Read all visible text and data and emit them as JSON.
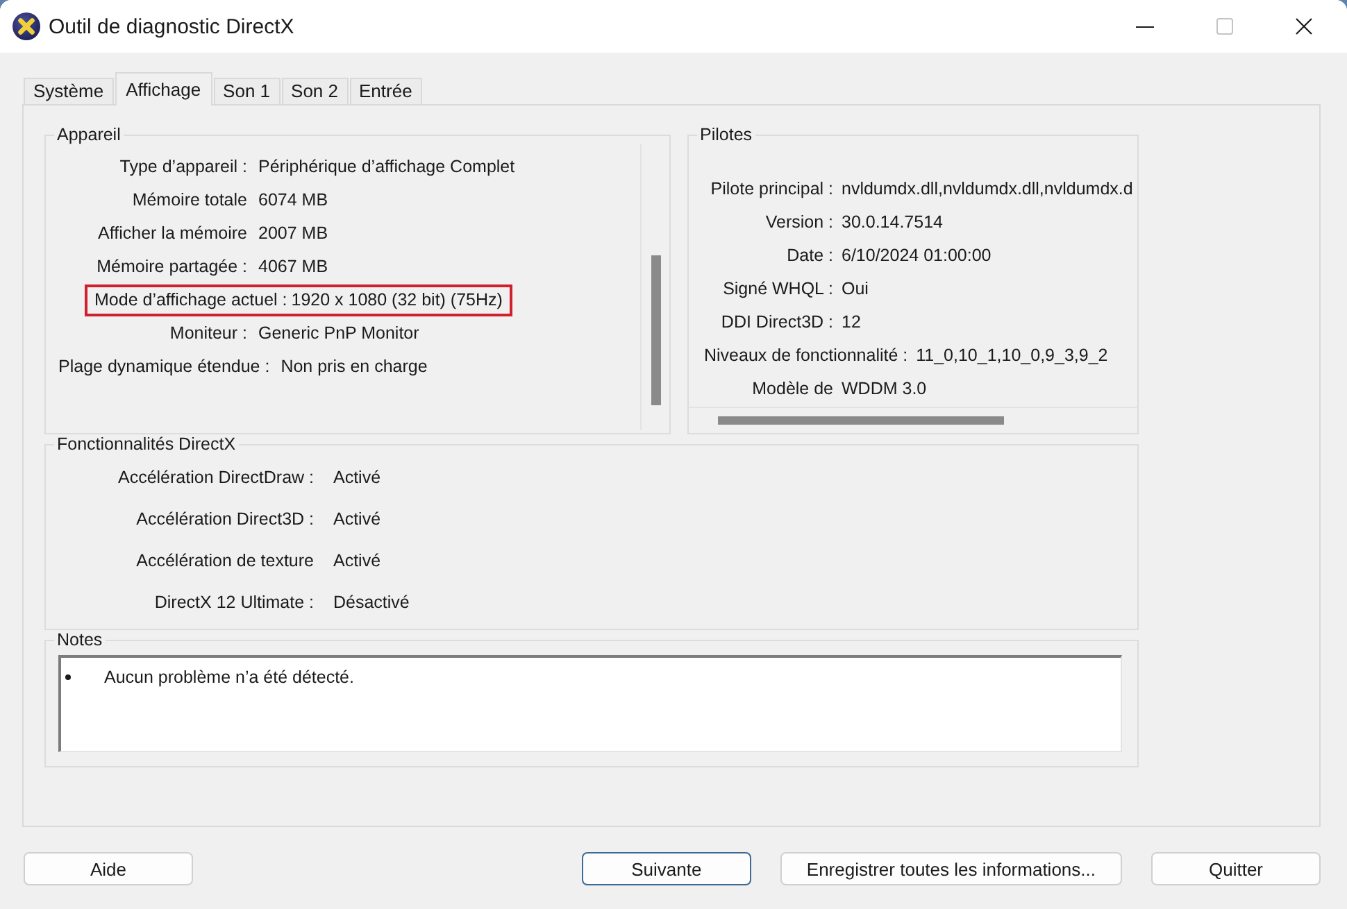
{
  "window": {
    "title": "Outil de diagnostic DirectX",
    "controls": [
      {
        "kind": "minimize",
        "disabled": false
      },
      {
        "kind": "maximize",
        "disabled": true
      },
      {
        "kind": "close",
        "disabled": false
      }
    ]
  },
  "tabs": [
    {
      "label": "Système",
      "selected": false
    },
    {
      "label": "Affichage",
      "selected": true
    },
    {
      "label": "Son 1",
      "selected": false
    },
    {
      "label": "Son 2",
      "selected": false
    },
    {
      "label": "Entrée",
      "selected": false
    }
  ],
  "device": {
    "title": "Appareil",
    "rows": [
      {
        "label": "Type d’appareil :",
        "value": "Périphérique d’affichage Complet",
        "highlighted": false
      },
      {
        "label": "Mémoire totale",
        "value": "6074 MB",
        "highlighted": false
      },
      {
        "label": "Afficher la mémoire",
        "value": "2007 MB",
        "highlighted": false
      },
      {
        "label": "Mémoire partagée :",
        "value": "4067 MB",
        "highlighted": false
      },
      {
        "label": "Mode d’affichage actuel :",
        "value": "1920 x 1080 (32 bit) (75Hz)",
        "highlighted": true
      },
      {
        "label": "Moniteur :",
        "value": "Generic PnP Monitor",
        "highlighted": false
      },
      {
        "label": "Plage dynamique étendue :",
        "value": "Non pris en charge",
        "highlighted": false
      }
    ]
  },
  "drivers": {
    "title": "Pilotes",
    "rows": [
      {
        "label": "Pilote principal :",
        "value": "nvldumdx.dll,nvldumdx.dll,nvldumdx.d"
      },
      {
        "label": "Version :",
        "value": "30.0.14.7514"
      },
      {
        "label": "Date :",
        "value": "6/10/2024 01:00:00"
      },
      {
        "label": "Signé WHQL :",
        "value": "Oui"
      },
      {
        "label": "DDI Direct3D :",
        "value": "12"
      },
      {
        "label": "Niveaux de fonctionnalité :",
        "value": "11_0,10_1,10_0,9_3,9_2"
      },
      {
        "label": "Modèle de",
        "value": "WDDM 3.0"
      }
    ]
  },
  "features": {
    "title": "Fonctionnalités DirectX",
    "rows": [
      {
        "label": "Accélération DirectDraw :",
        "value": "Activé"
      },
      {
        "label": "Accélération Direct3D :",
        "value": "Activé"
      },
      {
        "label": "Accélération de texture",
        "value": "Activé"
      },
      {
        "label": "DirectX 12 Ultimate :",
        "value": "Désactivé"
      }
    ]
  },
  "notes": {
    "title": "Notes",
    "items": [
      "Aucun problème n’a été détecté."
    ]
  },
  "buttons": [
    {
      "label": "Aide",
      "focused": false
    },
    {
      "label": "Suivante",
      "focused": true
    },
    {
      "label": "Enregistrer toutes les informations...",
      "focused": false
    },
    {
      "label": "Quitter",
      "focused": false
    }
  ]
}
